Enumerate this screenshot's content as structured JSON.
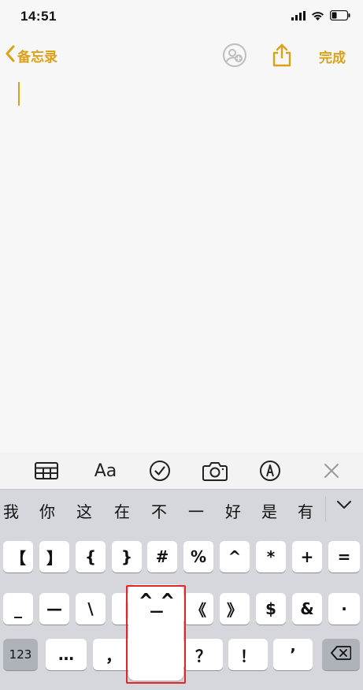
{
  "status": {
    "time": "14:51"
  },
  "nav": {
    "back_label": "备忘录",
    "done_label": "完成"
  },
  "toolbar": {
    "format_label": "Aa"
  },
  "candidates": [
    "我",
    "你",
    "这",
    "在",
    "不",
    "一",
    "好",
    "是",
    "有"
  ],
  "keyboard": {
    "row1": [
      "【",
      "】",
      "{",
      "}",
      "#",
      "%",
      "^",
      "*",
      "+",
      "="
    ],
    "row2": [
      "_",
      "—",
      "\\",
      "|",
      "^_^",
      "《",
      "》",
      "$",
      "&",
      "·"
    ],
    "row3": [
      "123",
      "…",
      "，",
      "？",
      "！",
      "’"
    ]
  },
  "popup": {
    "label": "^_^"
  },
  "colors": {
    "accent": "#d9a21b",
    "highlight": "#e0262b",
    "keyboard_bg": "#d5d7dc"
  }
}
